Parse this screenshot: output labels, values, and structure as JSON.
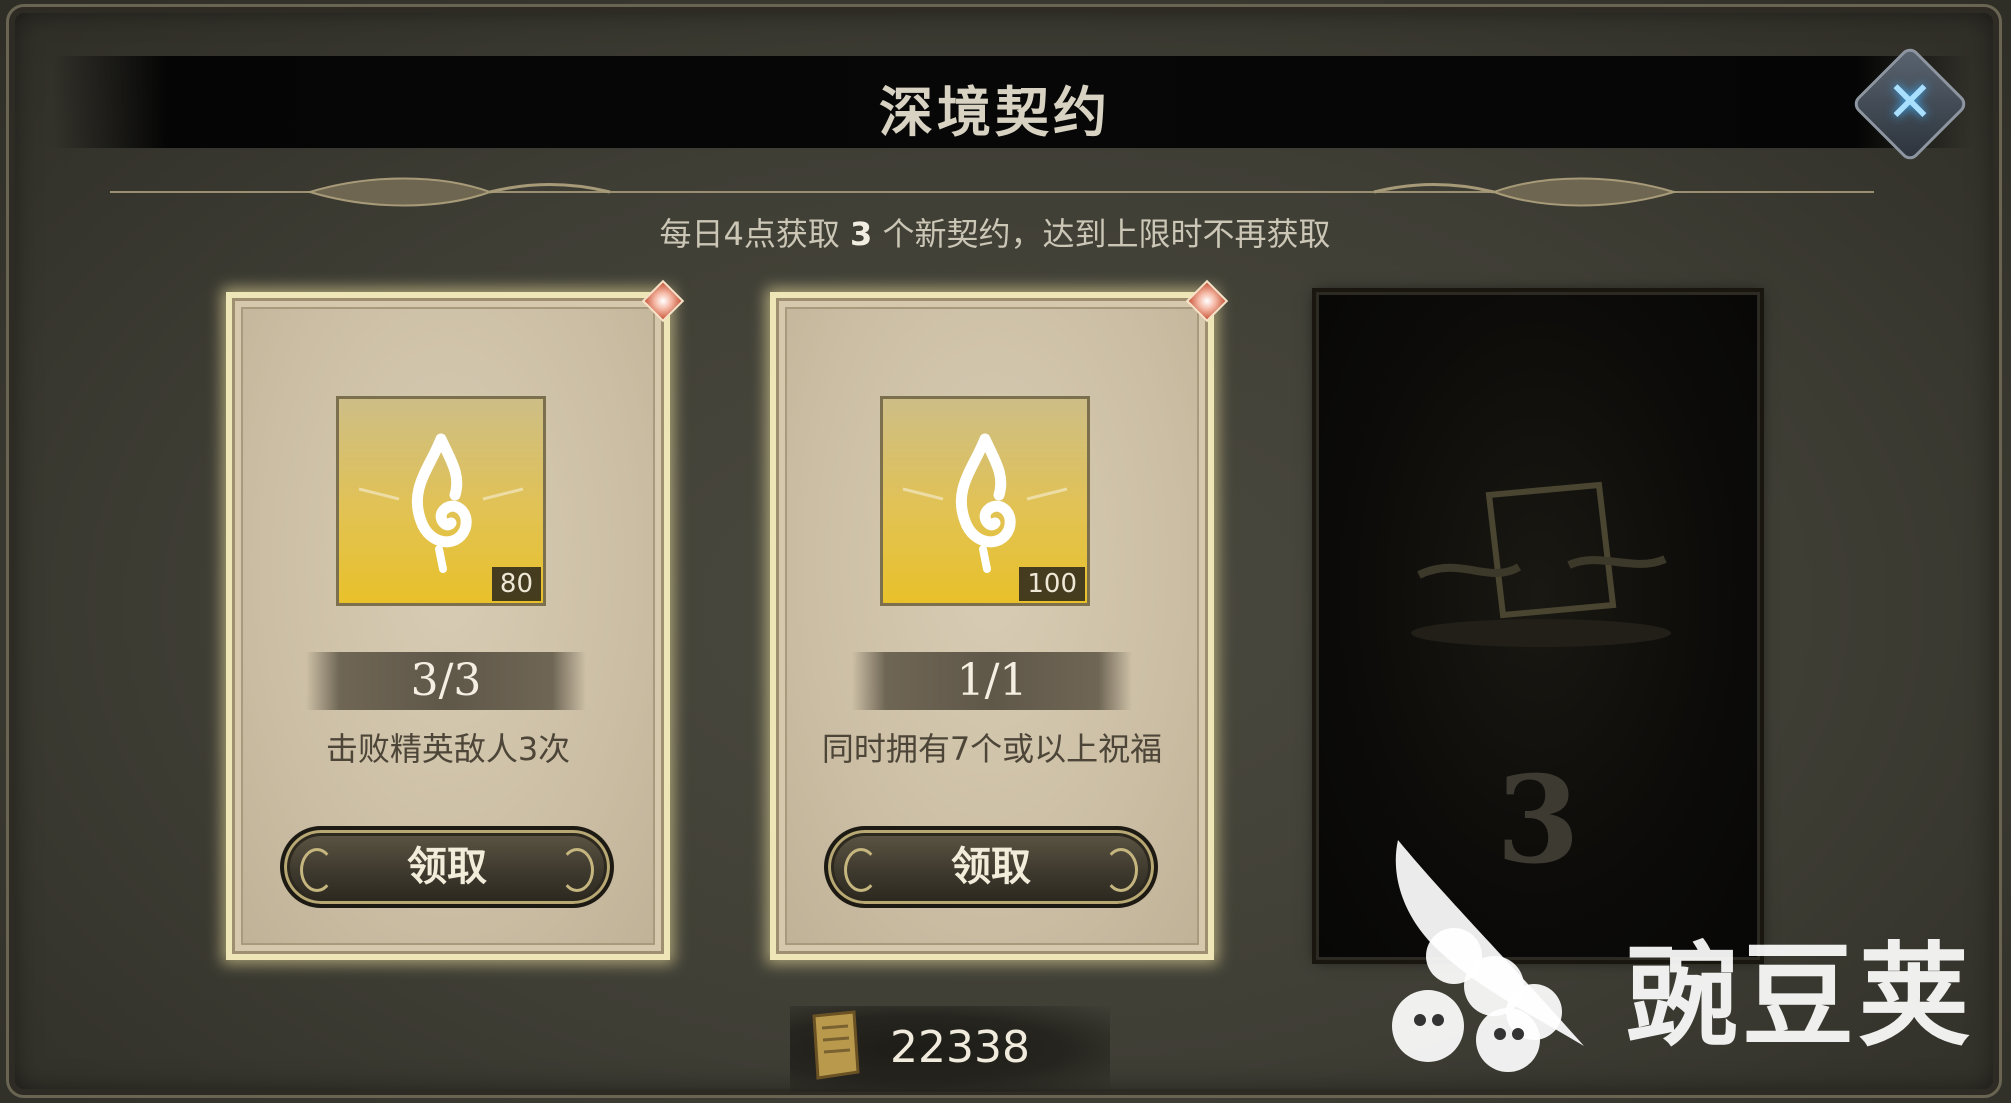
{
  "window": {
    "title": "深境契约",
    "close_icon": "close-icon",
    "subtitle_before": "每日4点获取 ",
    "subtitle_num": "3",
    "subtitle_after": " 个新契约，达到上限时不再获取"
  },
  "contracts": [
    {
      "icon": "flame-emblem-icon",
      "reward_count": "80",
      "progress": "3/3",
      "description": "击败精英敌人3次",
      "claim_label": "领取"
    },
    {
      "icon": "flame-emblem-icon",
      "reward_count": "100",
      "progress": "1/1",
      "description": "同时拥有7个或以上祝福",
      "claim_label": "领取"
    }
  ],
  "locked_slot": {
    "number": "3",
    "icon": "scroll-silhouette-icon"
  },
  "currency": {
    "icon": "parchment-scroll-icon",
    "amount": "22338"
  },
  "watermark": {
    "text": "豌豆荚",
    "icon": "pea-pod-logo-icon"
  },
  "colors": {
    "card_glow": "#efe6b8",
    "gold": "#e8c12a",
    "close_accent": "#a9e0ff"
  }
}
